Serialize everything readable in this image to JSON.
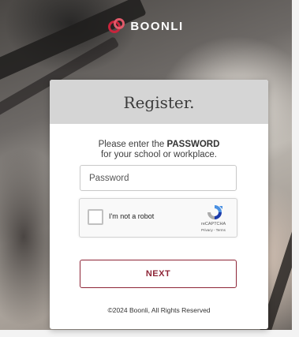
{
  "brand": {
    "name": "BOONLI",
    "accent_color": "#c8243c",
    "logo_icon": "boonli-logo-icon"
  },
  "card": {
    "title": "Register.",
    "instruction_prefix": "Please enter the ",
    "instruction_emphasis": "PASSWORD",
    "instruction_suffix": "for your school or workplace."
  },
  "password_field": {
    "value": "",
    "placeholder": "Password"
  },
  "captcha": {
    "checked": false,
    "label": "I'm not a robot",
    "brand": "reCAPTCHA",
    "links": "Privacy - Terms",
    "icon": "recaptcha-icon"
  },
  "next_button": {
    "label": "NEXT",
    "color": "#8e2537"
  },
  "footer": {
    "copyright": "©2024 Boonli, All Rights Reserved"
  }
}
